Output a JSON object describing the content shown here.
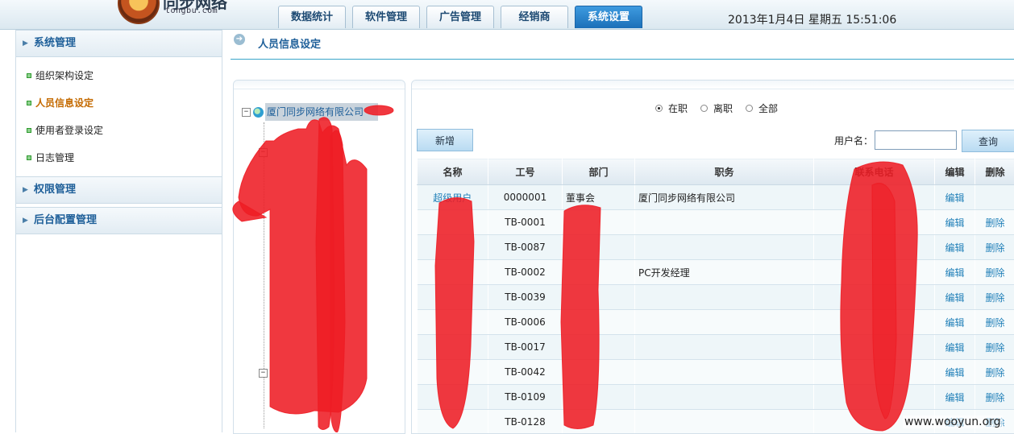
{
  "header": {
    "logo_text": "同步网络",
    "logo_sub": "tongbu.com",
    "tabs": [
      {
        "label": "数据统计",
        "active": false
      },
      {
        "label": "软件管理",
        "active": false
      },
      {
        "label": "广告管理",
        "active": false
      },
      {
        "label": "经销商",
        "active": false
      },
      {
        "label": "系统设置",
        "active": true
      }
    ],
    "datetime": "2013年1月4日  星期五  15:51:06"
  },
  "sidebar": {
    "groups": [
      {
        "label": "系统管理",
        "items": [
          {
            "label": "组织架构设定",
            "active": false
          },
          {
            "label": "人员信息设定",
            "active": true
          },
          {
            "label": "使用者登录设定",
            "active": false
          },
          {
            "label": "日志管理",
            "active": false
          }
        ]
      },
      {
        "label": "权限管理"
      },
      {
        "label": "后台配置管理"
      }
    ]
  },
  "breadcrumb": {
    "title": "人员信息设定"
  },
  "tree": {
    "root_label": "厦门同步网络有限公司"
  },
  "filters": {
    "options": [
      {
        "label": "在职",
        "checked": true
      },
      {
        "label": "离职",
        "checked": false
      },
      {
        "label": "全部",
        "checked": false
      }
    ],
    "add_label": "新增",
    "username_label": "用户名：",
    "username_value": "",
    "query_label": "查询"
  },
  "table": {
    "columns": [
      "名称",
      "工号",
      "部门",
      "职务",
      "联系电话",
      "编辑",
      "删除"
    ],
    "rows": [
      {
        "name": "超级用户",
        "id": "0000001",
        "dept": "董事会",
        "title": "厦门同步网络有限公司",
        "phone": "",
        "edit": "编辑",
        "delete": ""
      },
      {
        "name": "",
        "id": "TB-0001",
        "dept": "",
        "title": "",
        "phone": "",
        "edit": "编辑",
        "delete": "删除"
      },
      {
        "name": "",
        "id": "TB-0087",
        "dept": "",
        "title": "",
        "phone": "",
        "edit": "编辑",
        "delete": "删除"
      },
      {
        "name": "",
        "id": "TB-0002",
        "dept": "",
        "title": "PC开发经理",
        "phone": "",
        "edit": "编辑",
        "delete": "删除"
      },
      {
        "name": "",
        "id": "TB-0039",
        "dept": "",
        "title": "",
        "phone": "",
        "edit": "编辑",
        "delete": "删除"
      },
      {
        "name": "",
        "id": "TB-0006",
        "dept": "",
        "title": "",
        "phone": "",
        "edit": "编辑",
        "delete": "删除"
      },
      {
        "name": "",
        "id": "TB-0017",
        "dept": "",
        "title": "",
        "phone": "",
        "edit": "编辑",
        "delete": "删除"
      },
      {
        "name": "",
        "id": "TB-0042",
        "dept": "",
        "title": "",
        "phone": "",
        "edit": "编辑",
        "delete": "删除"
      },
      {
        "name": "",
        "id": "TB-0109",
        "dept": "",
        "title": "",
        "phone": "",
        "edit": "编辑",
        "delete": "删除"
      },
      {
        "name": "",
        "id": "TB-0128",
        "dept": "",
        "title": "",
        "phone": "",
        "edit": "编辑",
        "delete": "删除"
      }
    ]
  },
  "watermark": "www.wooyun.org",
  "colors": {
    "accent": "#1b6fb8",
    "redaction": "#ee1c24",
    "active_menu": "#c46a00"
  }
}
